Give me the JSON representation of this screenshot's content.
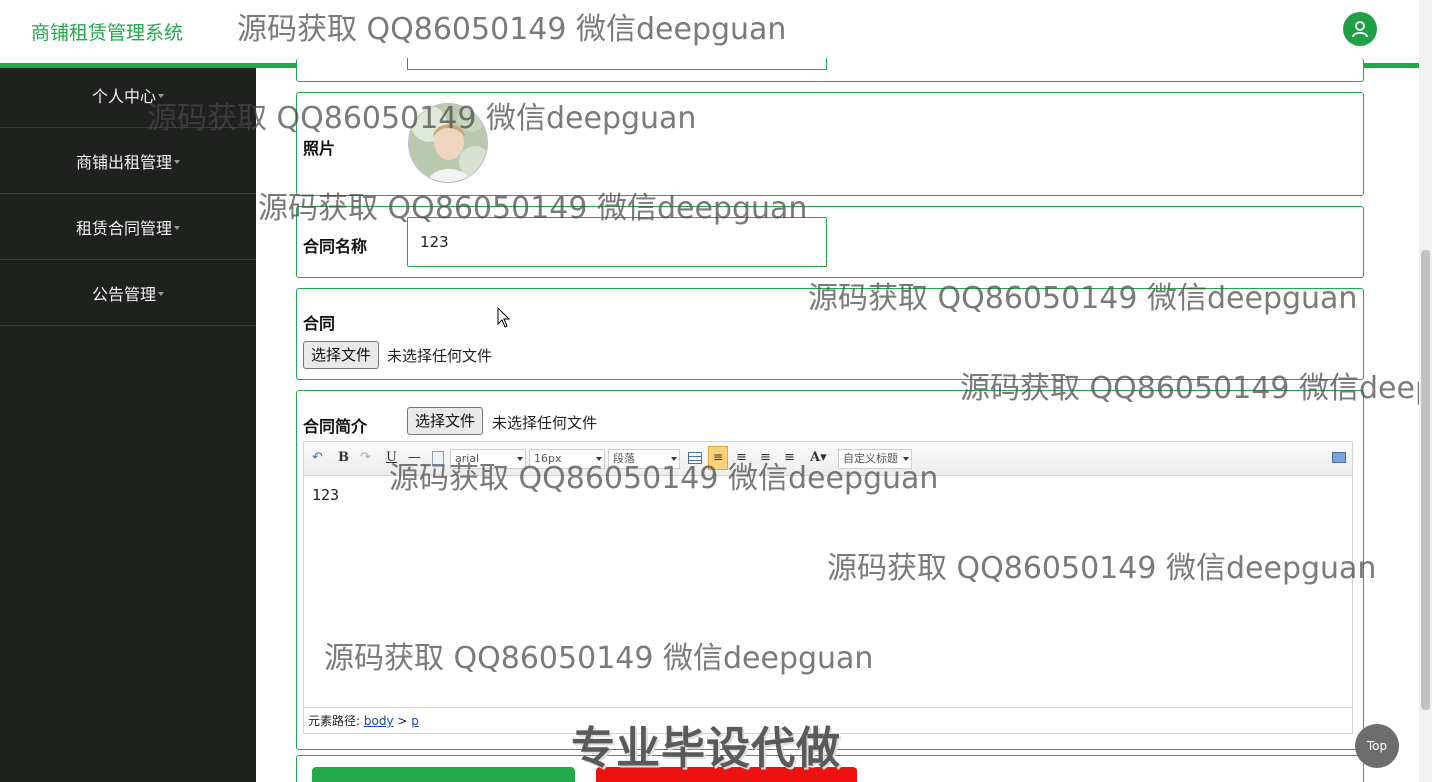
{
  "header": {
    "brand": "商铺租赁管理系统",
    "user_icon": "user-icon"
  },
  "sidebar": {
    "items": [
      {
        "label": "个人中心"
      },
      {
        "label": "商铺出租管理"
      },
      {
        "label": "租赁合同管理"
      },
      {
        "label": "公告管理"
      }
    ]
  },
  "form": {
    "photo_label": "照片",
    "name_label": "合同名称",
    "name_value": "123",
    "contract_label": "合同",
    "file_button": "选择文件",
    "file_status": "未选择任何文件",
    "intro_label": "合同简介",
    "intro_file_button": "选择文件",
    "intro_file_status": "未选择任何文件"
  },
  "editor": {
    "font_family": "arial",
    "font_size": "16px",
    "paragraph": "段落",
    "custom_title": "自定义标题",
    "content": "123",
    "path_label": "元素路径:",
    "path_body": "body",
    "path_sep": ">",
    "path_p": "p"
  },
  "watermarks": {
    "text": "源码获取 QQ86050149 微信deepguan",
    "text_cut": "源码获取 QQ86050149 微信deepg",
    "big": "专业毕设代做"
  },
  "top_button": "Top"
}
